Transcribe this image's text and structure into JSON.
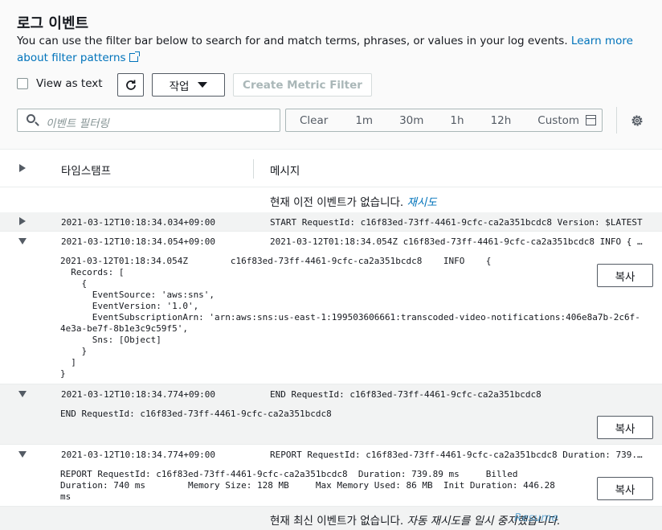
{
  "header": {
    "title": "로그 이벤트",
    "description": "You can use the filter bar below to search for and match terms, phrases, or values in your log events. ",
    "learn_more_link": "Learn more about filter patterns"
  },
  "toolbar": {
    "view_as_text_label": "View as text",
    "view_as_text_checked": false,
    "action_label": "작업",
    "create_metric_filter_label": "Create Metric Filter"
  },
  "filter": {
    "placeholder": "이벤트 필터링",
    "time_ranges": [
      "Clear",
      "1m",
      "30m",
      "1h",
      "12h",
      "Custom"
    ]
  },
  "table": {
    "col_timestamp": "타임스탬프",
    "col_message": "메시지",
    "no_older": "현재 이전 이벤트가 없습니다.",
    "retry_link": "재시도",
    "no_newer": "현재 최신 이벤트가 없습니다.",
    "no_newer_italic": "자동 재시도를 일시 중지했습니다.",
    "resume_link": "Resume",
    "copy_label": "복사",
    "rows": [
      {
        "timestamp": "2021-03-12T10:18:34.034+09:00",
        "message": "START RequestId: c16f83ed-73ff-4461-9cfc-ca2a351bcdc8 Version: $LATEST",
        "expanded": false,
        "detail": ""
      },
      {
        "timestamp": "2021-03-12T10:18:34.054+09:00",
        "message": "2021-03-12T01:18:34.054Z c16f83ed-73ff-4461-9cfc-ca2a351bcdc8 INFO { …",
        "expanded": true,
        "detail": "2021-03-12T01:18:34.054Z        c16f83ed-73ff-4461-9cfc-ca2a351bcdc8    INFO    {\n  Records: [\n    {\n      EventSource: 'aws:sns',\n      EventVersion: '1.0',\n      EventSubscriptionArn: 'arn:aws:sns:us-east-1:199503606661:transcoded-video-notifications:406e8a7b-2c6f-\n4e3a-be7f-8b1e3c9c59f5',\n      Sns: [Object]\n    }\n  ]\n}"
      },
      {
        "timestamp": "2021-03-12T10:18:34.774+09:00",
        "message": "END RequestId: c16f83ed-73ff-4461-9cfc-ca2a351bcdc8",
        "expanded": true,
        "detail": "END RequestId: c16f83ed-73ff-4461-9cfc-ca2a351bcdc8"
      },
      {
        "timestamp": "2021-03-12T10:18:34.774+09:00",
        "message": "REPORT RequestId: c16f83ed-73ff-4461-9cfc-ca2a351bcdc8 Duration: 739.…",
        "expanded": true,
        "detail": "REPORT RequestId: c16f83ed-73ff-4461-9cfc-ca2a351bcdc8  Duration: 739.89 ms     Billed\nDuration: 740 ms        Memory Size: 128 MB     Max Memory Used: 86 MB  Init Duration: 446.28\nms"
      }
    ]
  }
}
